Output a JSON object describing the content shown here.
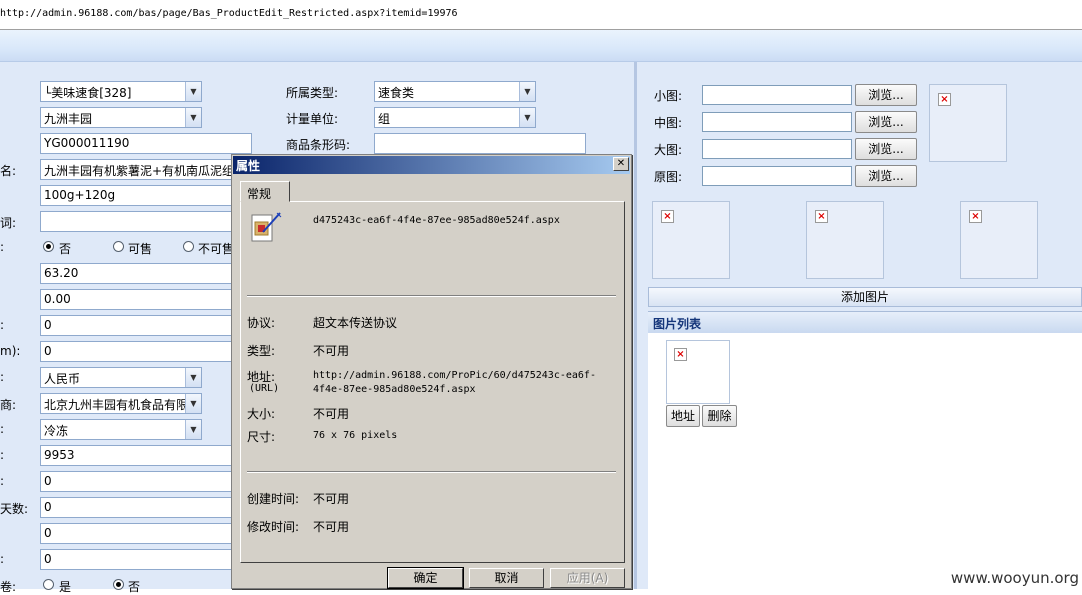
{
  "address": {
    "url": "http://admin.96188.com/bas/page/Bas_ProductEdit_Restricted.aspx?itemid=19976"
  },
  "form": {
    "category_value": "└美味速食[328]",
    "brand_value": "九洲丰园",
    "code_value": "YG000011190",
    "name_label": "名:",
    "name_value": "九洲丰园有机紫薯泥+有机南瓜泥组",
    "spec_value": "100g+120g",
    "keyword_label": "词:",
    "radio_label": ":",
    "radio_no": "否",
    "radio_sale": "可售",
    "radio_nosale": "不可售",
    "price1_value": "63.20",
    "price2_value": "0.00",
    "colon1": ":",
    "field_a_value": "0",
    "m_label": "m):",
    "field_b_value": "0",
    "colon2": ":",
    "currency_value": "人民币",
    "supplier_label": "商:",
    "supplier_value": "北京九州丰园有机食品有限",
    "colon3": ":",
    "storage_value": "冷冻",
    "colon4": ":",
    "stock_value": "9953",
    "colon5": ":",
    "field_c_value": "0",
    "days_label": "天数:",
    "field_d_value": "0",
    "field_e_value": "0",
    "colon6": ":",
    "field_f_value": "0",
    "bottom_label": "卷:",
    "bottom_yes": "是",
    "bottom_no": "否",
    "type_label": "所属类型:",
    "type_value": "速食类",
    "unit_label": "计量单位:",
    "unit_value": "组",
    "barcode_label": "商品条形码:"
  },
  "images": {
    "small_label": "小图:",
    "medium_label": "中图:",
    "large_label": "大图:",
    "original_label": "原图:",
    "browse_label": "浏览...",
    "add_button": "添加图片",
    "list_title": "图片列表",
    "address_button": "地址",
    "delete_button": "删除"
  },
  "dialog": {
    "title": "属性",
    "close": "✕",
    "tab": "常规",
    "filename": "d475243c-ea6f-4f4e-87ee-985ad80e524f.aspx",
    "protocol_label": "协议:",
    "protocol_value": "超文本传送协议",
    "type_label": "类型:",
    "type_value": "不可用",
    "address_label": "地址:",
    "address_sub": "(URL)",
    "address_value_line1": "http://admin.96188.com/ProPic/60/d475243c-ea6f-",
    "address_value_line2": "4f4e-87ee-985ad80e524f.aspx",
    "size_label": "大小:",
    "size_value": "不可用",
    "dimension_label": "尺寸:",
    "dimension_value": "76  x  76  pixels",
    "created_label": "创建时间:",
    "created_value": "不可用",
    "modified_label": "修改时间:",
    "modified_value": "不可用",
    "ok_button": "确定",
    "cancel_button": "取消",
    "apply_button": "应用(A)"
  },
  "watermark": "www.wooyun.org"
}
